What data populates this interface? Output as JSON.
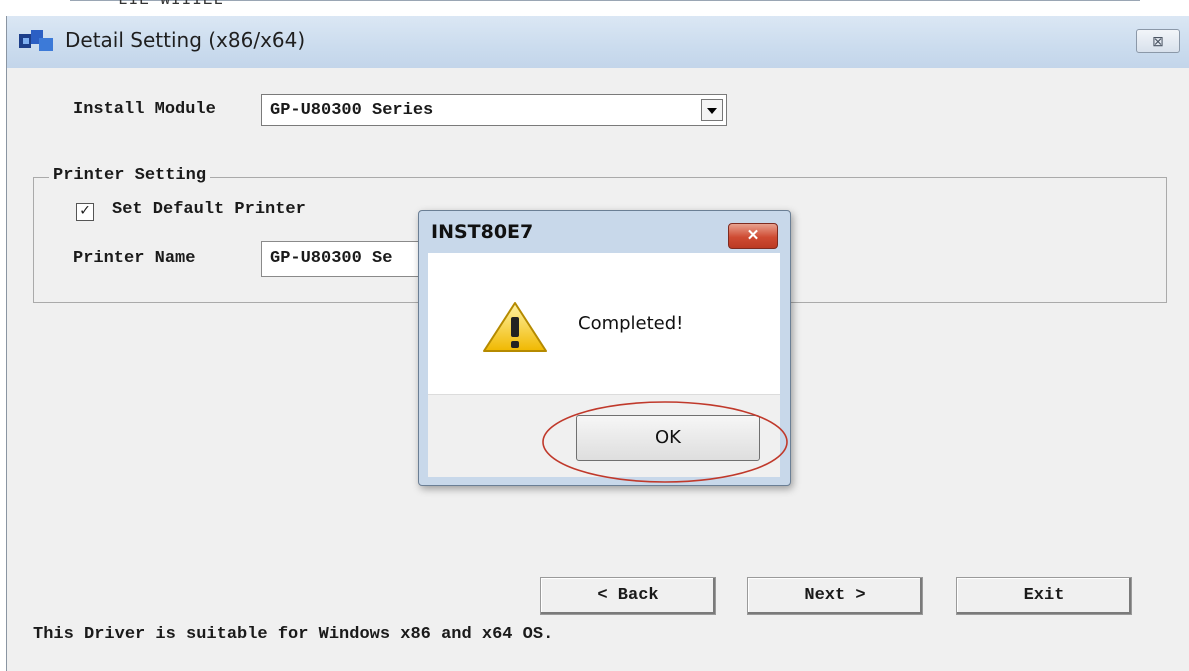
{
  "background_window": {
    "title_fragment": "LIE WIIIEL"
  },
  "window": {
    "title": "Detail Setting (x86/x64)",
    "close_symbol": "⊠",
    "icon": "app-icon",
    "titlebar_color": "#cbdcee"
  },
  "install_module": {
    "label": "Install Module",
    "selected": "GP-U80300 Series"
  },
  "printer_setting": {
    "legend": "Printer Setting",
    "set_default_label": "Set Default Printer",
    "set_default_checked": true,
    "check_mark": "✓",
    "printer_name_label": "Printer Name",
    "printer_name_value": "GP-U80300 Se"
  },
  "buttons": {
    "back": "< Back",
    "next": "Next >",
    "exit": "Exit"
  },
  "footer_note": "This Driver is suitable for Windows x86 and x64 OS.",
  "dialog": {
    "title": "INST80E7",
    "close_symbol": "✕",
    "message": "Completed!",
    "icon": "warning-icon",
    "ok_label": "OK",
    "close_color": "#cf4b33",
    "annotation_color": "#c0392b"
  }
}
